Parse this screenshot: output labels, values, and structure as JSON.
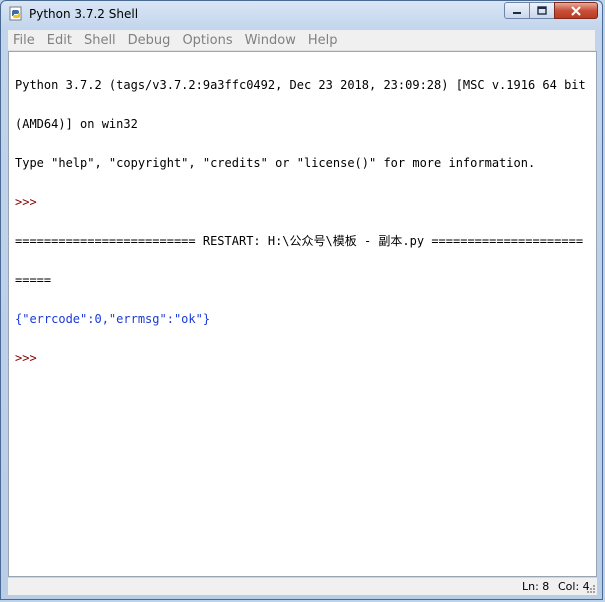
{
  "window": {
    "title": "Python 3.7.2 Shell"
  },
  "menu": [
    {
      "label": "File"
    },
    {
      "label": "Edit"
    },
    {
      "label": "Shell"
    },
    {
      "label": "Debug"
    },
    {
      "label": "Options"
    },
    {
      "label": "Window"
    },
    {
      "label": "Help"
    }
  ],
  "shell": {
    "lines": [
      {
        "text": "Python 3.7.2 (tags/v3.7.2:9a3ffc0492, Dec 23 2018, 23:09:28) [MSC v.1916 64 bit",
        "style": "out"
      },
      {
        "text": "(AMD64)] on win32",
        "style": "out"
      },
      {
        "text": "Type \"help\", \"copyright\", \"credits\" or \"license()\" for more information.",
        "style": "out"
      },
      {
        "text": ">>> ",
        "style": "prompt"
      },
      {
        "text": "========================= RESTART: H:\\公众号\\模板 - 副本.py =====================",
        "style": "out"
      },
      {
        "text": "=====",
        "style": "out"
      },
      {
        "text": "{\"errcode\":0,\"errmsg\":\"ok\"}",
        "style": "result"
      },
      {
        "text": ">>> ",
        "style": "prompt"
      }
    ]
  },
  "status": {
    "line": "Ln: 8",
    "col": "Col: 4"
  },
  "colors": {
    "prompt": "#8b0000",
    "result": "#1a3ad6",
    "menu_text": "#808080"
  },
  "icons": [
    "python-app-icon",
    "minimize-icon",
    "maximize-icon",
    "close-icon",
    "size-grip-icon"
  ]
}
